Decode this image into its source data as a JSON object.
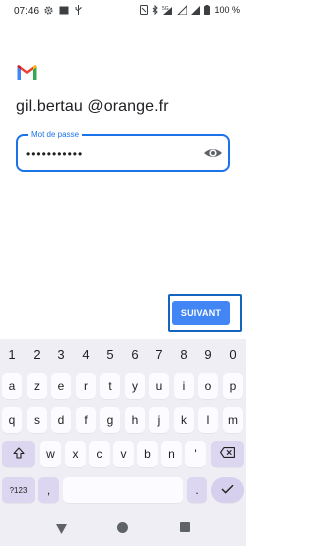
{
  "status_bar": {
    "time": "07:46",
    "left_icons": [
      "gear-icon",
      "screen-icon",
      "usb-icon"
    ],
    "right_icons": [
      "nfc-icon",
      "bluetooth-icon",
      "5g-signal-icon",
      "wifi-icon",
      "signal-icon",
      "battery-icon"
    ],
    "battery": "100 %"
  },
  "login": {
    "logo": "gmail-logo",
    "email": "gil.bertau @orange.fr",
    "password_label": "Mot de passe",
    "password_value": "•••••••••••",
    "toggle_visibility_icon": "eye-icon",
    "next_button": "SUIVANT"
  },
  "keyboard": {
    "number_row": [
      "1",
      "2",
      "3",
      "4",
      "5",
      "6",
      "7",
      "8",
      "9",
      "0"
    ],
    "row1": [
      "a",
      "z",
      "e",
      "r",
      "t",
      "y",
      "u",
      "i",
      "o",
      "p"
    ],
    "row2": [
      "q",
      "s",
      "d",
      "f",
      "g",
      "h",
      "j",
      "k",
      "l",
      "m"
    ],
    "row3": [
      "w",
      "x",
      "c",
      "v",
      "b",
      "n",
      "'"
    ],
    "symbols_key": "?123",
    "comma": ",",
    "period": ".",
    "shift_icon": "shift-icon",
    "backspace_icon": "backspace-icon",
    "enter_icon": "check-icon"
  },
  "nav_bar": {
    "icons": [
      "back-icon",
      "home-icon",
      "recents-icon"
    ]
  },
  "colors": {
    "accent": "#1a73e8",
    "button": "#4285f4",
    "keyboard_bg": "#f0eef5",
    "key_bg": "#fcfbff",
    "mod_key_bg": "#dcd6f0"
  }
}
